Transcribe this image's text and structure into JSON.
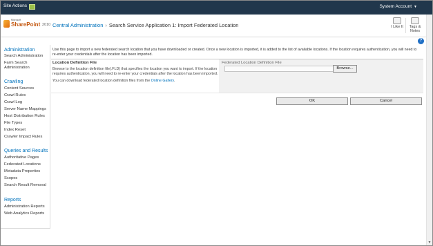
{
  "topbar": {
    "site_actions": "Site Actions",
    "system_account": "System Account"
  },
  "header": {
    "logo_small": "Microsoft",
    "logo_product": "SharePoint",
    "logo_version": "2010",
    "breadcrumb_root": "Central Administration",
    "breadcrumb_separator": "›",
    "breadcrumb_current": "Search Service Application 1: Import Federated Location",
    "like_label": "I Like It",
    "tags_label": "Tags & Notes"
  },
  "sidebar": {
    "sections": [
      {
        "heading": "Administration",
        "items": [
          "Search Administration",
          "Farm Search Administration"
        ]
      },
      {
        "heading": "Crawling",
        "items": [
          "Content Sources",
          "Crawl Rules",
          "Crawl Log",
          "Server Name Mappings",
          "Host Distribution Rules",
          "File Types",
          "Index Reset",
          "Crawler Impact Rules"
        ]
      },
      {
        "heading": "Queries and Results",
        "items": [
          "Authoritative Pages",
          "Federated Locations",
          "Metadata Properties",
          "Scopes",
          "Search Result Removal"
        ]
      },
      {
        "heading": "Reports",
        "items": [
          "Administration Reports",
          "Web Analytics Reports"
        ]
      }
    ]
  },
  "main": {
    "intro": "Use this page to import a new federated search location that you have downloaded or created. Once a new location is imported, it is added to the list of available locations. If the location requires authentication, you will need to re-enter your credentials after the location has been imported.",
    "section_title": "Location Definition File",
    "section_desc": "Browse to the location definition file(.FLD) that specifies the location you want to import. If the location requires authentication, you will need to re-enter your credentials after the location has been imported.",
    "download_text": "You can download federated location definition files from the",
    "download_link": "Online Gallery",
    "download_suffix": ".",
    "field_label": "Federated Location Definition File",
    "browse_label": "Browse...",
    "ok_label": "OK",
    "cancel_label": "Cancel"
  }
}
